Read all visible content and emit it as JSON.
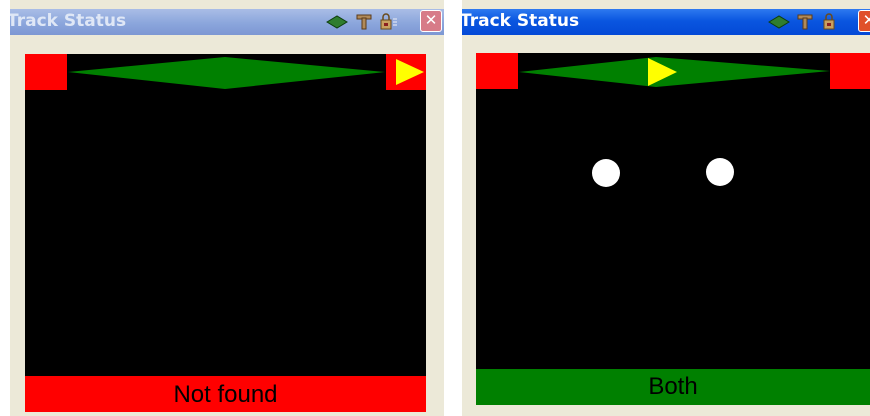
{
  "windows": [
    {
      "title": "Track Status",
      "title_state": "inactive",
      "status_text": "Not found",
      "status_color": "#ff0000",
      "direction_arrow": "right-end",
      "detected_objects": 0
    },
    {
      "title": "Track Status",
      "title_state": "active",
      "status_text": "Both",
      "status_color": "#008000",
      "direction_arrow": "center",
      "detected_objects": 2
    }
  ],
  "titlebar_icons": [
    "diamond-icon",
    "t-pin-icon",
    "lock-icon",
    "close-icon"
  ],
  "colors": {
    "track": "#008000",
    "end_marker": "#ff0000",
    "arrow": "#ffff00",
    "object": "#ffffff",
    "display_bg": "#000000"
  }
}
